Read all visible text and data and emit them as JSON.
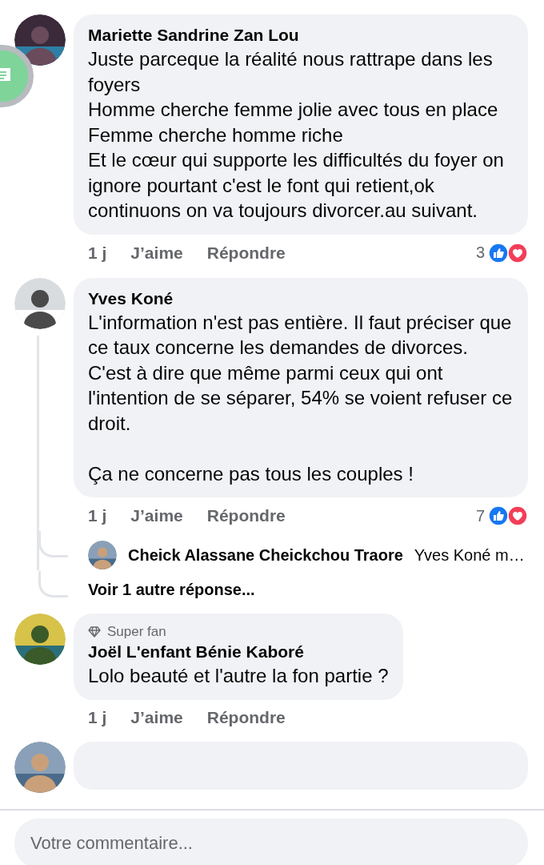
{
  "comments": [
    {
      "kind": "comment",
      "author": "Mariette Sandrine Zan Lou",
      "sections": [
        [
          "Juste parceque la réalité nous rattrape dans les foyers",
          "Homme cherche femme jolie avec tous en place",
          "Femme cherche homme riche",
          "Et le cœur qui supporte les difficultés du foyer on ignore pourtant c'est le font qui retient,ok continuons on va toujours divorcer.au suivant."
        ]
      ],
      "time": "1 j",
      "like": "J’aime",
      "reply": "Répondre",
      "reactions": "3"
    },
    {
      "kind": "comment",
      "author": "Yves Koné",
      "sections": [
        [
          "L'information n'est pas entière. Il faut préciser que ce taux concerne les demandes de divorces. C'est à dire que même parmi ceux qui ont l'intention de se séparer, 54% se voient refuser ce droit."
        ],
        [
          "Ça ne concerne pas tous les couples !"
        ]
      ],
      "time": "1 j",
      "like": "J’aime",
      "reply": "Répondre",
      "reactions": "7",
      "replies": [
        {
          "author": "Cheick Alassane Cheickchou Traore",
          "text": "Yves Koné m…"
        }
      ],
      "more_replies": "Voir 1 autre réponse..."
    },
    {
      "kind": "comment",
      "badge": "Super fan",
      "author": "Joël L'enfant Bénie Kaboré",
      "sections": [
        [
          "Lolo beauté et l'autre la fon partie ?"
        ]
      ],
      "time": "1 j",
      "like": "J’aime",
      "reply": "Répondre"
    },
    {
      "kind": "cut"
    }
  ],
  "composer": {
    "placeholder": "Votre commentaire..."
  }
}
